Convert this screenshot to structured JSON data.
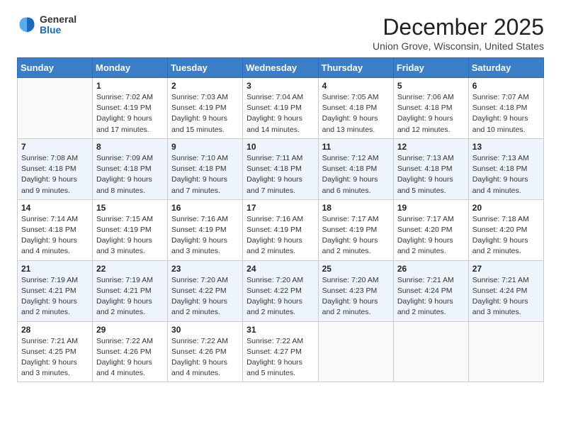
{
  "header": {
    "logo": {
      "general": "General",
      "blue": "Blue"
    },
    "title": "December 2025",
    "location": "Union Grove, Wisconsin, United States"
  },
  "weekdays": [
    "Sunday",
    "Monday",
    "Tuesday",
    "Wednesday",
    "Thursday",
    "Friday",
    "Saturday"
  ],
  "weeks": [
    [
      {
        "day": "",
        "sunrise": "",
        "sunset": "",
        "daylight": ""
      },
      {
        "day": "1",
        "sunrise": "Sunrise: 7:02 AM",
        "sunset": "Sunset: 4:19 PM",
        "daylight": "Daylight: 9 hours and 17 minutes."
      },
      {
        "day": "2",
        "sunrise": "Sunrise: 7:03 AM",
        "sunset": "Sunset: 4:19 PM",
        "daylight": "Daylight: 9 hours and 15 minutes."
      },
      {
        "day": "3",
        "sunrise": "Sunrise: 7:04 AM",
        "sunset": "Sunset: 4:19 PM",
        "daylight": "Daylight: 9 hours and 14 minutes."
      },
      {
        "day": "4",
        "sunrise": "Sunrise: 7:05 AM",
        "sunset": "Sunset: 4:18 PM",
        "daylight": "Daylight: 9 hours and 13 minutes."
      },
      {
        "day": "5",
        "sunrise": "Sunrise: 7:06 AM",
        "sunset": "Sunset: 4:18 PM",
        "daylight": "Daylight: 9 hours and 12 minutes."
      },
      {
        "day": "6",
        "sunrise": "Sunrise: 7:07 AM",
        "sunset": "Sunset: 4:18 PM",
        "daylight": "Daylight: 9 hours and 10 minutes."
      }
    ],
    [
      {
        "day": "7",
        "sunrise": "Sunrise: 7:08 AM",
        "sunset": "Sunset: 4:18 PM",
        "daylight": "Daylight: 9 hours and 9 minutes."
      },
      {
        "day": "8",
        "sunrise": "Sunrise: 7:09 AM",
        "sunset": "Sunset: 4:18 PM",
        "daylight": "Daylight: 9 hours and 8 minutes."
      },
      {
        "day": "9",
        "sunrise": "Sunrise: 7:10 AM",
        "sunset": "Sunset: 4:18 PM",
        "daylight": "Daylight: 9 hours and 7 minutes."
      },
      {
        "day": "10",
        "sunrise": "Sunrise: 7:11 AM",
        "sunset": "Sunset: 4:18 PM",
        "daylight": "Daylight: 9 hours and 7 minutes."
      },
      {
        "day": "11",
        "sunrise": "Sunrise: 7:12 AM",
        "sunset": "Sunset: 4:18 PM",
        "daylight": "Daylight: 9 hours and 6 minutes."
      },
      {
        "day": "12",
        "sunrise": "Sunrise: 7:13 AM",
        "sunset": "Sunset: 4:18 PM",
        "daylight": "Daylight: 9 hours and 5 minutes."
      },
      {
        "day": "13",
        "sunrise": "Sunrise: 7:13 AM",
        "sunset": "Sunset: 4:18 PM",
        "daylight": "Daylight: 9 hours and 4 minutes."
      }
    ],
    [
      {
        "day": "14",
        "sunrise": "Sunrise: 7:14 AM",
        "sunset": "Sunset: 4:18 PM",
        "daylight": "Daylight: 9 hours and 4 minutes."
      },
      {
        "day": "15",
        "sunrise": "Sunrise: 7:15 AM",
        "sunset": "Sunset: 4:19 PM",
        "daylight": "Daylight: 9 hours and 3 minutes."
      },
      {
        "day": "16",
        "sunrise": "Sunrise: 7:16 AM",
        "sunset": "Sunset: 4:19 PM",
        "daylight": "Daylight: 9 hours and 3 minutes."
      },
      {
        "day": "17",
        "sunrise": "Sunrise: 7:16 AM",
        "sunset": "Sunset: 4:19 PM",
        "daylight": "Daylight: 9 hours and 2 minutes."
      },
      {
        "day": "18",
        "sunrise": "Sunrise: 7:17 AM",
        "sunset": "Sunset: 4:19 PM",
        "daylight": "Daylight: 9 hours and 2 minutes."
      },
      {
        "day": "19",
        "sunrise": "Sunrise: 7:17 AM",
        "sunset": "Sunset: 4:20 PM",
        "daylight": "Daylight: 9 hours and 2 minutes."
      },
      {
        "day": "20",
        "sunrise": "Sunrise: 7:18 AM",
        "sunset": "Sunset: 4:20 PM",
        "daylight": "Daylight: 9 hours and 2 minutes."
      }
    ],
    [
      {
        "day": "21",
        "sunrise": "Sunrise: 7:19 AM",
        "sunset": "Sunset: 4:21 PM",
        "daylight": "Daylight: 9 hours and 2 minutes."
      },
      {
        "day": "22",
        "sunrise": "Sunrise: 7:19 AM",
        "sunset": "Sunset: 4:21 PM",
        "daylight": "Daylight: 9 hours and 2 minutes."
      },
      {
        "day": "23",
        "sunrise": "Sunrise: 7:20 AM",
        "sunset": "Sunset: 4:22 PM",
        "daylight": "Daylight: 9 hours and 2 minutes."
      },
      {
        "day": "24",
        "sunrise": "Sunrise: 7:20 AM",
        "sunset": "Sunset: 4:22 PM",
        "daylight": "Daylight: 9 hours and 2 minutes."
      },
      {
        "day": "25",
        "sunrise": "Sunrise: 7:20 AM",
        "sunset": "Sunset: 4:23 PM",
        "daylight": "Daylight: 9 hours and 2 minutes."
      },
      {
        "day": "26",
        "sunrise": "Sunrise: 7:21 AM",
        "sunset": "Sunset: 4:24 PM",
        "daylight": "Daylight: 9 hours and 2 minutes."
      },
      {
        "day": "27",
        "sunrise": "Sunrise: 7:21 AM",
        "sunset": "Sunset: 4:24 PM",
        "daylight": "Daylight: 9 hours and 3 minutes."
      }
    ],
    [
      {
        "day": "28",
        "sunrise": "Sunrise: 7:21 AM",
        "sunset": "Sunset: 4:25 PM",
        "daylight": "Daylight: 9 hours and 3 minutes."
      },
      {
        "day": "29",
        "sunrise": "Sunrise: 7:22 AM",
        "sunset": "Sunset: 4:26 PM",
        "daylight": "Daylight: 9 hours and 4 minutes."
      },
      {
        "day": "30",
        "sunrise": "Sunrise: 7:22 AM",
        "sunset": "Sunset: 4:26 PM",
        "daylight": "Daylight: 9 hours and 4 minutes."
      },
      {
        "day": "31",
        "sunrise": "Sunrise: 7:22 AM",
        "sunset": "Sunset: 4:27 PM",
        "daylight": "Daylight: 9 hours and 5 minutes."
      },
      {
        "day": "",
        "sunrise": "",
        "sunset": "",
        "daylight": ""
      },
      {
        "day": "",
        "sunrise": "",
        "sunset": "",
        "daylight": ""
      },
      {
        "day": "",
        "sunrise": "",
        "sunset": "",
        "daylight": ""
      }
    ]
  ]
}
